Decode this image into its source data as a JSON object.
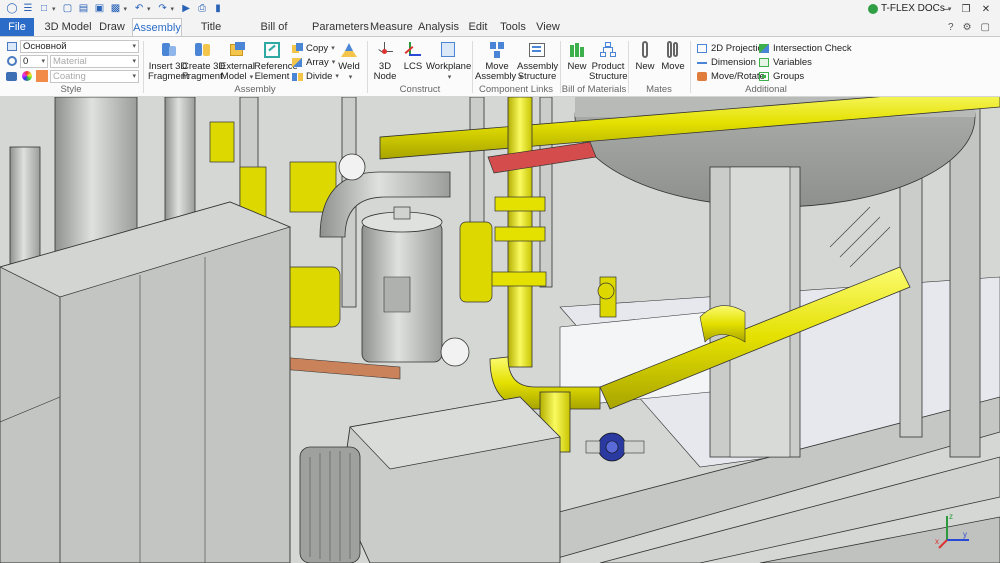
{
  "app": {
    "brand": "T-FLEX DOCs"
  },
  "quick_access": {
    "icons": [
      "app-icon",
      "menu-icon",
      "new-icon",
      "open-icon",
      "template-icon",
      "window-icon",
      "save-icon",
      "undo-icon",
      "redo-icon",
      "export-icon",
      "print-icon",
      "document-icon"
    ]
  },
  "window_controls": {
    "minimize": "–",
    "restore": "❐",
    "close": "✕"
  },
  "tabs": [
    {
      "label": "File"
    },
    {
      "label": "3D Model"
    },
    {
      "label": "Draw"
    },
    {
      "label": "Assembly"
    },
    {
      "label": "Title Block"
    },
    {
      "label": "Bill of Materials"
    },
    {
      "label": "Parameters"
    },
    {
      "label": "Measure"
    },
    {
      "label": "Analysis"
    },
    {
      "label": "Edit"
    },
    {
      "label": "Tools"
    },
    {
      "label": "View"
    }
  ],
  "tab_right": {
    "help": "?",
    "settings": "⚙",
    "window": "▢"
  },
  "ribbon": {
    "style": {
      "label": "Style",
      "layer_value": "Основной",
      "level_value": "0",
      "material_placeholder": "Material",
      "coating_placeholder": "Coating",
      "color": "#f28a48"
    },
    "assembly": {
      "label": "Assembly",
      "insert_fragment": "Insert 3D\nFragment",
      "create_fragment": "Create 3D\nFragment",
      "external_model": "External\nModel",
      "reference_element": "Reference\nElement",
      "copy": "Copy",
      "array": "Array",
      "divide": "Divide",
      "weld": "Weld"
    },
    "construct": {
      "label": "Construct",
      "node": "3D\nNode",
      "lcs": "LCS",
      "workplane": "Workplane"
    },
    "component_links": {
      "label": "Component Links",
      "move_assembly": "Move\nAssembly",
      "assembly_structure": "Assembly\nStructure"
    },
    "bom": {
      "label": "Bill of Materials",
      "new": "New",
      "product_structure": "Product\nStructure"
    },
    "mates": {
      "label": "Mates",
      "new": "New",
      "move": "Move"
    },
    "additional": {
      "label": "Additional",
      "projection": "2D Projection",
      "dimension": "Dimension",
      "move_rotate": "Move/Rotate",
      "intersection_check": "Intersection Check",
      "variables": "Variables",
      "groups": "Groups"
    }
  },
  "triad": {
    "x": "x",
    "y": "y",
    "z": "z"
  },
  "colors": {
    "accent": "#2b6cc8",
    "pipe_yellow": "#e8e400",
    "frame_gray": "#c9ccc8",
    "background": "#d9dcd9"
  }
}
